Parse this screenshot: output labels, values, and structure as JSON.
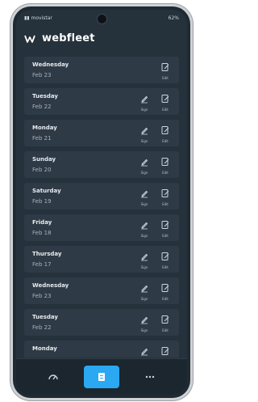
{
  "status_bar": {
    "carrier": "movistar",
    "right": "62%"
  },
  "brand": {
    "name": "webfleet"
  },
  "entries": [
    {
      "day": "Wednesday",
      "date": "Feb 23",
      "actions": [
        {
          "label": "Edit",
          "icon": "edit-icon"
        }
      ]
    },
    {
      "day": "Tuesday",
      "date": "Feb 22",
      "actions": [
        {
          "label": "Sign",
          "icon": "sign-icon"
        },
        {
          "label": "Edit",
          "icon": "edit-icon"
        }
      ]
    },
    {
      "day": "Monday",
      "date": "Feb 21",
      "actions": [
        {
          "label": "Sign",
          "icon": "sign-icon"
        },
        {
          "label": "Edit",
          "icon": "edit-icon"
        }
      ]
    },
    {
      "day": "Sunday",
      "date": "Feb 20",
      "actions": [
        {
          "label": "Sign",
          "icon": "sign-icon"
        },
        {
          "label": "Edit",
          "icon": "edit-icon"
        }
      ]
    },
    {
      "day": "Saturday",
      "date": "Feb 19",
      "actions": [
        {
          "label": "Sign",
          "icon": "sign-icon"
        },
        {
          "label": "Edit",
          "icon": "edit-icon"
        }
      ]
    },
    {
      "day": "Friday",
      "date": "Feb 18",
      "actions": [
        {
          "label": "Sign",
          "icon": "sign-icon"
        },
        {
          "label": "Edit",
          "icon": "edit-icon"
        }
      ]
    },
    {
      "day": "Thursday",
      "date": "Feb 17",
      "actions": [
        {
          "label": "Sign",
          "icon": "sign-icon"
        },
        {
          "label": "Edit",
          "icon": "edit-icon"
        }
      ]
    },
    {
      "day": "Wednesday",
      "date": "Feb 23",
      "actions": [
        {
          "label": "Sign",
          "icon": "sign-icon"
        },
        {
          "label": "Edit",
          "icon": "edit-icon"
        }
      ]
    },
    {
      "day": "Tuesday",
      "date": "Feb 22",
      "actions": [
        {
          "label": "Sign",
          "icon": "sign-icon"
        },
        {
          "label": "Edit",
          "icon": "edit-icon"
        }
      ]
    },
    {
      "day": "Monday",
      "date": "",
      "actions": [
        {
          "label": "",
          "icon": "sign-icon"
        },
        {
          "label": "",
          "icon": "edit-icon"
        }
      ]
    }
  ],
  "bottom_nav": [
    {
      "icon": "dashboard-icon",
      "active": false
    },
    {
      "icon": "logbook-icon",
      "active": true
    },
    {
      "icon": "more-icon",
      "active": false
    }
  ],
  "colors": {
    "accent": "#2aa8f2",
    "card": "#2e3a45",
    "background": "#25313b"
  }
}
